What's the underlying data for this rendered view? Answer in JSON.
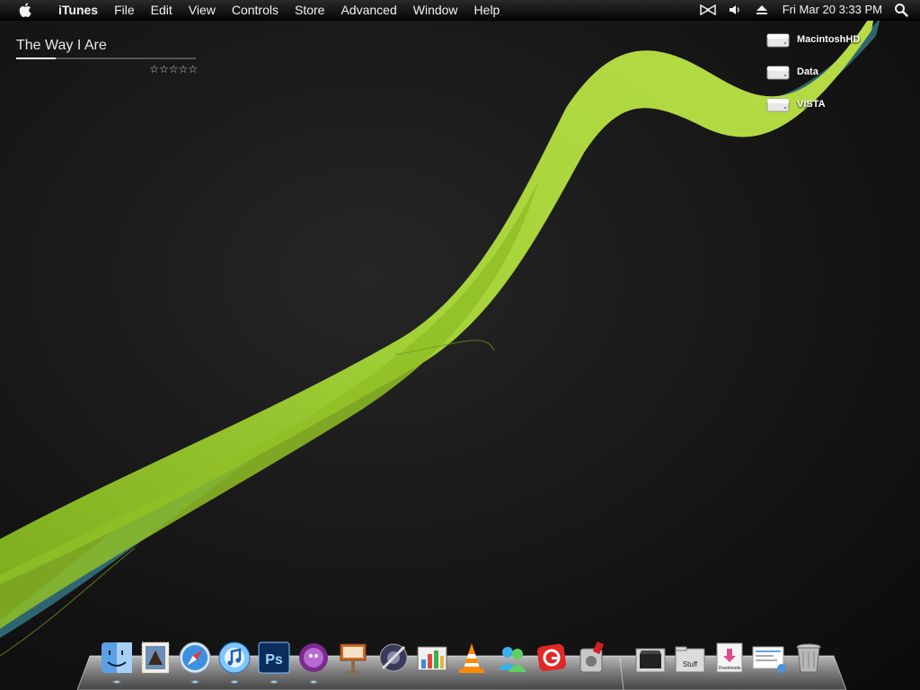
{
  "menubar": {
    "apple_icon": "apple-icon",
    "app_name": "iTunes",
    "items": [
      "File",
      "Edit",
      "View",
      "Controls",
      "Store",
      "Advanced",
      "Window",
      "Help"
    ],
    "status_icons": [
      "bowtie-icon",
      "volume-icon",
      "eject-icon"
    ],
    "clock": "Fri Mar 20  3:33 PM",
    "spotlight_icon": "spotlight-search-icon"
  },
  "now_playing": {
    "title": "The Way I Are",
    "progress": 0.22,
    "rating_stars": "☆☆☆☆☆"
  },
  "desktop": {
    "drives": [
      {
        "label": "MacintoshHD",
        "icon": "hard-drive-icon"
      },
      {
        "label": "Data",
        "icon": "hard-drive-icon"
      },
      {
        "label": "VISTA",
        "icon": "hard-drive-icon"
      }
    ],
    "colors": {
      "ribbon_green": "#9acd32",
      "ribbon_teal": "#3f8d9a",
      "background": "#161616"
    }
  },
  "dock": {
    "items": [
      {
        "name": "finder-icon",
        "glyph": "",
        "running": true
      },
      {
        "name": "mail-stamp-icon",
        "glyph": "",
        "running": false
      },
      {
        "name": "safari-compass-icon",
        "glyph": "",
        "running": true
      },
      {
        "name": "itunes-icon",
        "glyph": "",
        "running": true
      },
      {
        "name": "photoshop-icon",
        "glyph": "Ps",
        "running": true
      },
      {
        "name": "adium-icon",
        "glyph": "",
        "running": true
      },
      {
        "name": "keynote-icon",
        "glyph": "",
        "running": false
      },
      {
        "name": "system-preferences-icon",
        "glyph": "",
        "running": false
      },
      {
        "name": "charts-app-icon",
        "glyph": "",
        "running": false
      },
      {
        "name": "vlc-cone-icon",
        "glyph": "",
        "running": false
      },
      {
        "name": "messenger-buddies-icon",
        "glyph": "",
        "running": false
      },
      {
        "name": "red-g-app-icon",
        "glyph": "G",
        "running": false
      },
      {
        "name": "gear-tool-app-icon",
        "glyph": "",
        "running": false
      },
      {
        "name": "movies-folder-icon",
        "glyph": "",
        "running": false
      },
      {
        "name": "stuff-folder-icon",
        "glyph": "Stuff",
        "running": false
      },
      {
        "name": "downloads-folder-icon",
        "glyph": "Downloads",
        "running": false
      },
      {
        "name": "documents-stack-icon",
        "glyph": "",
        "running": false
      },
      {
        "name": "trash-icon",
        "glyph": "",
        "running": false
      }
    ]
  }
}
